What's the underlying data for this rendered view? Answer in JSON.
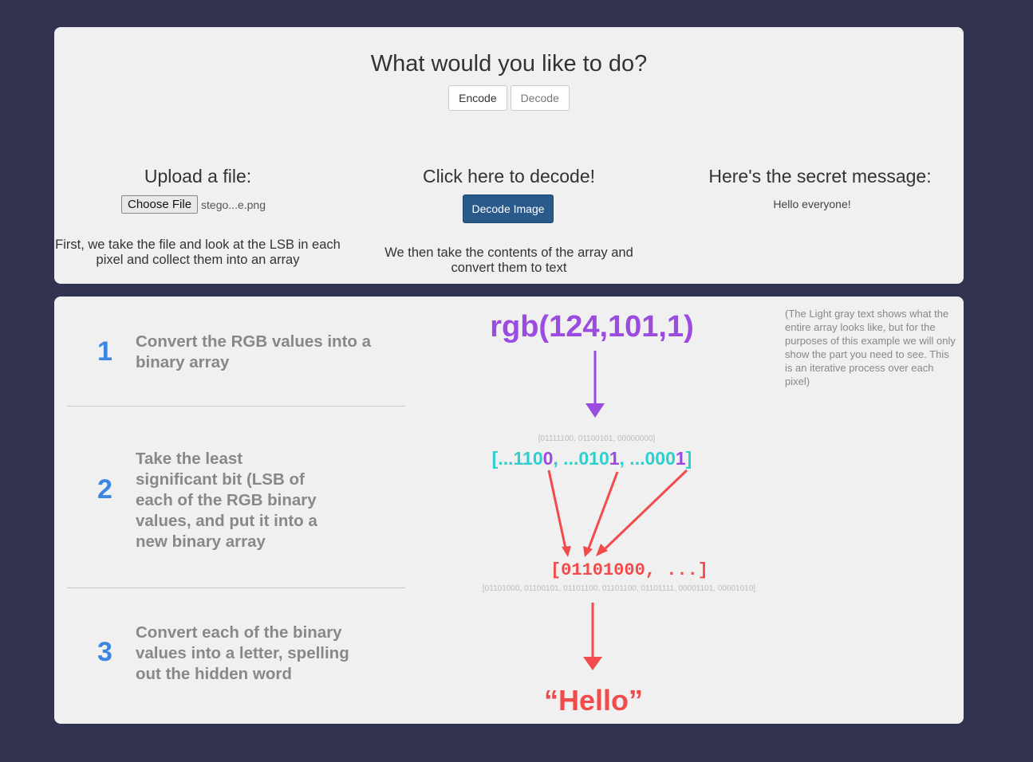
{
  "header": {
    "title": "What would you like to do?",
    "encode_label": "Encode",
    "decode_label": "Decode"
  },
  "upload": {
    "heading": "Upload a file:",
    "choose_label": "Choose File",
    "file_name": "stego...e.png",
    "description": "First, we take the file and look at the LSB in each pixel and collect them into an array"
  },
  "decode": {
    "heading": "Click here to decode!",
    "button_label": "Decode Image",
    "description": "We then take the contents of the array and convert them to text"
  },
  "secret": {
    "heading": "Here's the secret message:",
    "message": "Hello everyone!"
  },
  "steps": [
    {
      "number": "1",
      "text": "Convert the RGB values into a binary array"
    },
    {
      "number": "2",
      "text": "Take the least significant bit (LSB of each of the RGB binary values, and put it into a new binary array"
    },
    {
      "number": "3",
      "text": "Convert each of the binary values into a letter, spelling out the hidden word"
    }
  ],
  "diagram": {
    "rgb_label": "rgb(124,101,1)",
    "full_binary_gray": "[01111100, 01100101, 00000000]",
    "binary_parts": [
      "[...110",
      "0",
      ", ...010",
      "1",
      ", ...000",
      "1",
      "]"
    ],
    "lsb_array": "[01101000, ...]",
    "full_bytes_gray": "[01101000, 01100101, 01101100, 01101100, 01101111, 00001101, 00001010]",
    "result_word": "“Hello”",
    "note": "(The Light gray text shows what the entire array looks like, but for the purposes of this example we will only show the part you need to see. This is an iterative process over each pixel)",
    "colors": {
      "purple": "#9b4be0",
      "teal": "#2fcfcf",
      "red": "#f24b4b",
      "gray": "#bbbbbb",
      "blue": "#3a86e0"
    }
  }
}
